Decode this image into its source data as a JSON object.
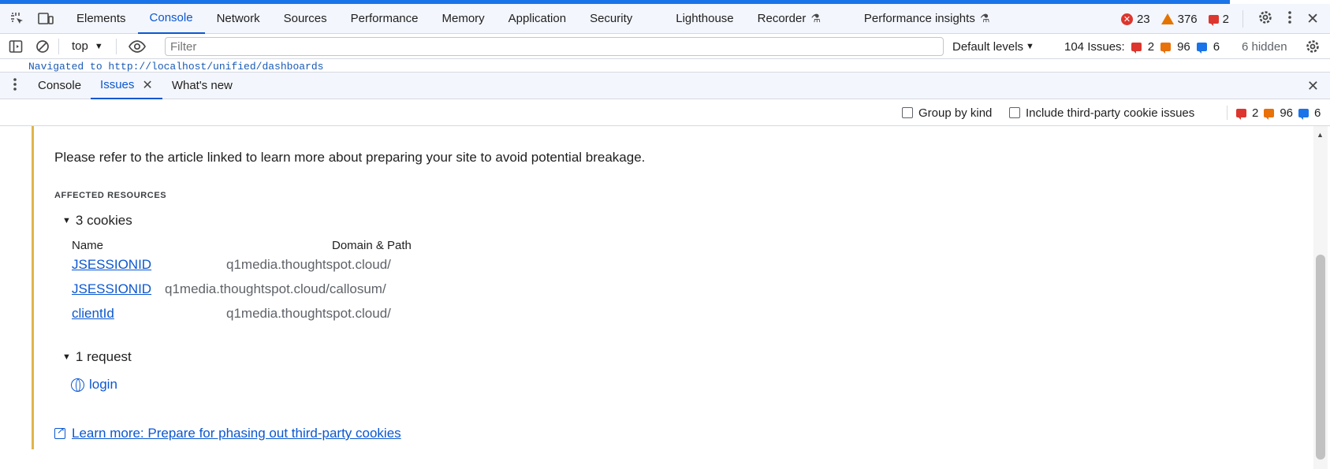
{
  "main_tabs": [
    "Elements",
    "Console",
    "Network",
    "Sources",
    "Performance",
    "Memory",
    "Application",
    "Security",
    "Lighthouse",
    "Recorder",
    "Performance insights"
  ],
  "main_active_tab": "Console",
  "status_counts": {
    "errors": "23",
    "warnings": "376",
    "issues": "2"
  },
  "console_toolbar": {
    "context": "top",
    "filter_placeholder": "Filter",
    "levels_label": "Default levels",
    "issues_label": "104 Issues:",
    "issue_counts": {
      "red": "2",
      "orange": "96",
      "blue": "6"
    },
    "hidden_label": "6 hidden"
  },
  "console_line": "Navigated to http://localhost/unified/dashboards",
  "drawer_tabs": [
    "Console",
    "Issues",
    "What's new"
  ],
  "drawer_active_tab": "Issues",
  "issues_toolbar": {
    "group_by_kind": "Group by kind",
    "include_third_party": "Include third-party cookie issues",
    "counts": {
      "red": "2",
      "orange": "96",
      "blue": "6"
    }
  },
  "issue": {
    "description": "Please refer to the article linked to learn more about preparing your site to avoid potential breakage.",
    "affected_heading": "AFFECTED RESOURCES",
    "cookies_toggle": "3 cookies",
    "cookie_columns": {
      "name": "Name",
      "domain": "Domain & Path"
    },
    "cookies": [
      {
        "name": "JSESSIONID",
        "domain": "q1media.thoughtspot.cloud/"
      },
      {
        "name": "JSESSIONID",
        "domain": "q1media.thoughtspot.cloud/callosum/"
      },
      {
        "name": "clientId",
        "domain": "q1media.thoughtspot.cloud/"
      }
    ],
    "requests_toggle": "1 request",
    "requests": [
      {
        "name": "login"
      }
    ],
    "learn_more": "Learn more: Prepare for phasing out third-party cookies"
  },
  "colors": {
    "accent": "#0b57d0",
    "error": "#dc362e",
    "warning": "#e8710a",
    "info": "#1a73e8",
    "issue_border": "#e0b34c"
  }
}
